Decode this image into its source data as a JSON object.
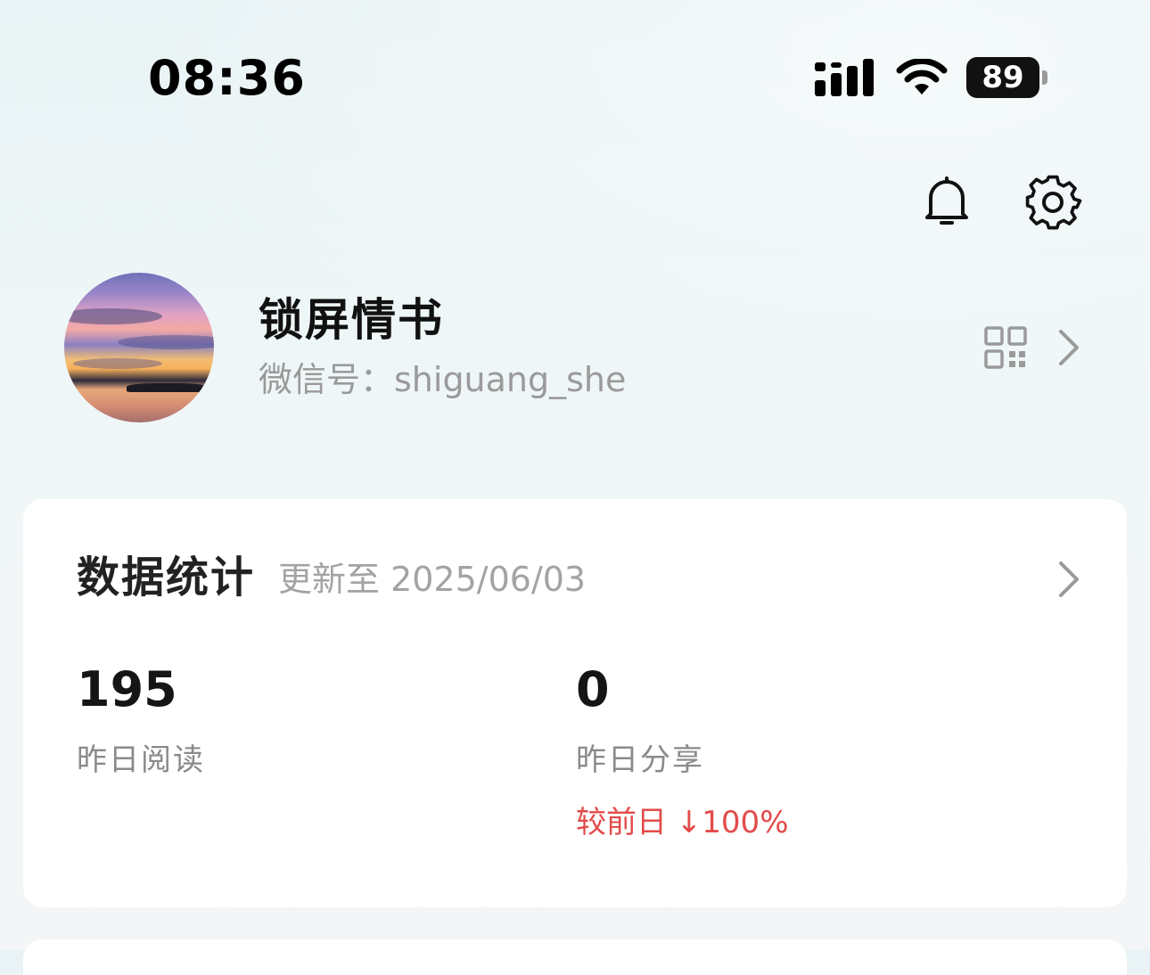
{
  "status_bar": {
    "time": "08:36",
    "battery": "89"
  },
  "icons": {
    "signal": "signal-bars-icon",
    "wifi": "wifi-icon",
    "battery": "battery-icon",
    "bell": "bell-icon",
    "settings": "gear-icon",
    "qr": "qr-code-icon",
    "chevron": "chevron-right-icon"
  },
  "profile": {
    "name": "锁屏情书",
    "wechat_id": "微信号：shiguang_she"
  },
  "stats": {
    "title": "数据统计",
    "updated": "更新至 2025/06/03",
    "items": [
      {
        "value": "195",
        "label": "昨日阅读",
        "change": ""
      },
      {
        "value": "0",
        "label": "昨日分享",
        "change": "较前日 ↓100%"
      }
    ]
  },
  "colors": {
    "background": "#eef6f7",
    "card": "#ffffff",
    "decrease": "#e34b4b",
    "muted_text": "#9a9a9a"
  }
}
